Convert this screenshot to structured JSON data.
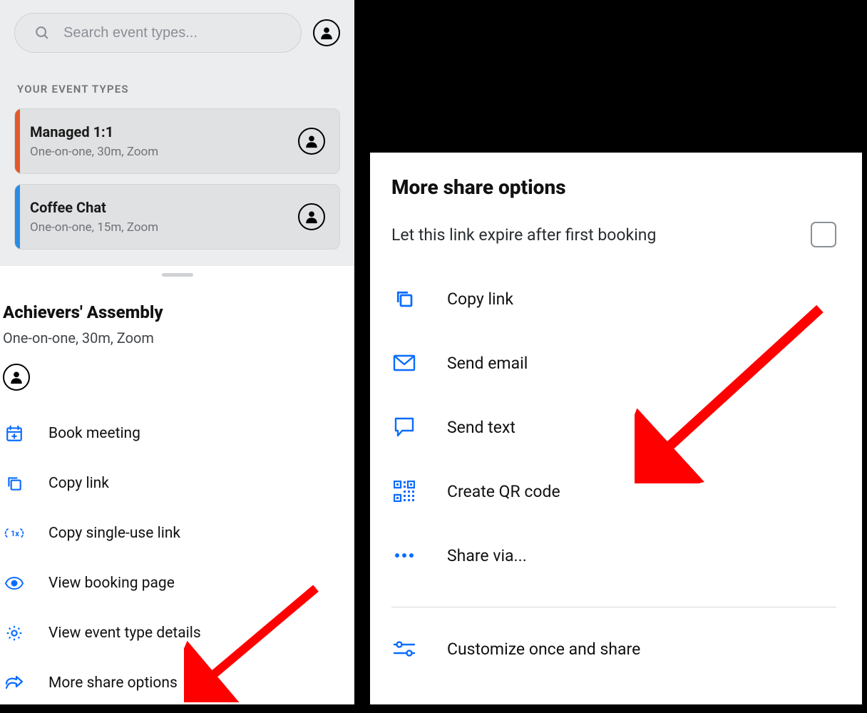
{
  "search": {
    "placeholder": "Search event types..."
  },
  "section_label": "YOUR EVENT TYPES",
  "event_cards": [
    {
      "title": "Managed 1:1",
      "sub": "One-on-one, 30m, Zoom",
      "stripe": "orange"
    },
    {
      "title": "Coffee Chat",
      "sub": "One-on-one, 15m, Zoom",
      "stripe": "blue"
    }
  ],
  "selected_event": {
    "title": "Achievers' Assembly",
    "sub": "One-on-one, 30m, Zoom"
  },
  "actions": [
    {
      "label": "Book meeting"
    },
    {
      "label": "Copy link"
    },
    {
      "label": "Copy single-use link"
    },
    {
      "label": "View booking page"
    },
    {
      "label": "View event type details"
    },
    {
      "label": "More share options"
    }
  ],
  "share_panel": {
    "title": "More share options",
    "expire_label": "Let this link expire after first booking",
    "options": [
      {
        "label": "Copy link"
      },
      {
        "label": "Send email"
      },
      {
        "label": "Send text"
      },
      {
        "label": "Create QR code"
      },
      {
        "label": "Share via..."
      }
    ],
    "customize_label": "Customize once and share"
  }
}
